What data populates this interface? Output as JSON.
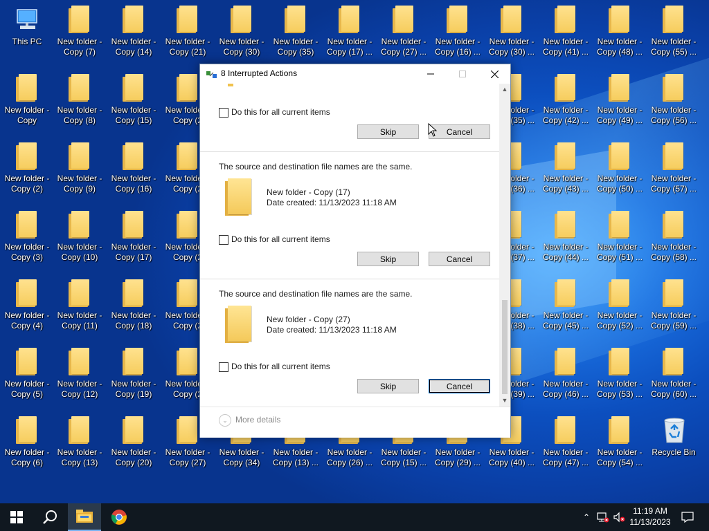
{
  "desktop": {
    "icons": [
      {
        "label": "This PC",
        "type": "pc"
      },
      {
        "label": "New folder - Copy (7)",
        "type": "folder"
      },
      {
        "label": "New folder - Copy (14)",
        "type": "folder"
      },
      {
        "label": "New folder - Copy (21)",
        "type": "folder"
      },
      {
        "label": "New folder - Copy (30)",
        "type": "folder"
      },
      {
        "label": "New folder - Copy (35)",
        "type": "folder"
      },
      {
        "label": "New folder - Copy (17) ...",
        "type": "folder"
      },
      {
        "label": "New folder - Copy (27) ...",
        "type": "folder"
      },
      {
        "label": "New folder - Copy (16) ...",
        "type": "folder"
      },
      {
        "label": "New folder - Copy (30) ...",
        "type": "folder"
      },
      {
        "label": "New folder - Copy (41) ...",
        "type": "folder"
      },
      {
        "label": "New folder - Copy (48) ...",
        "type": "folder"
      },
      {
        "label": "New folder - Copy (55) ...",
        "type": "folder"
      },
      {
        "label": "New folder - Copy",
        "type": "folder"
      },
      {
        "label": "New folder - Copy (8)",
        "type": "folder"
      },
      {
        "label": "New folder - Copy (15)",
        "type": "folder"
      },
      {
        "label": "New folder - Copy (2",
        "type": "folder"
      },
      {
        "label": "New folder - Copy (35) ...",
        "type": "folder"
      },
      {
        "label": "New folder - Copy (42) ...",
        "type": "folder"
      },
      {
        "label": "New folder - Copy (49) ...",
        "type": "folder"
      },
      {
        "label": "New folder - Copy (56) ...",
        "type": "folder"
      },
      {
        "label": "New folder - Copy (2)",
        "type": "folder"
      },
      {
        "label": "New folder - Copy (9)",
        "type": "folder"
      },
      {
        "label": "New folder - Copy (16)",
        "type": "folder"
      },
      {
        "label": "New folder - Copy (2",
        "type": "folder"
      },
      {
        "label": "New folder - Copy (36) ...",
        "type": "folder"
      },
      {
        "label": "New folder - Copy (43) ...",
        "type": "folder"
      },
      {
        "label": "New folder - Copy (50) ...",
        "type": "folder"
      },
      {
        "label": "New folder - Copy (57) ...",
        "type": "folder"
      },
      {
        "label": "New folder - Copy (3)",
        "type": "folder"
      },
      {
        "label": "New folder - Copy (10)",
        "type": "folder"
      },
      {
        "label": "New folder - Copy (17)",
        "type": "folder"
      },
      {
        "label": "New folder - Copy (2",
        "type": "folder"
      },
      {
        "label": "New folder - Copy (37) ...",
        "type": "folder"
      },
      {
        "label": "New folder - Copy (44) ...",
        "type": "folder"
      },
      {
        "label": "New folder - Copy (51) ...",
        "type": "folder"
      },
      {
        "label": "New folder - Copy (58) ...",
        "type": "folder"
      },
      {
        "label": "New folder - Copy (4)",
        "type": "folder"
      },
      {
        "label": "New folder - Copy (11)",
        "type": "folder"
      },
      {
        "label": "New folder - Copy (18)",
        "type": "folder"
      },
      {
        "label": "New folder - Copy (2",
        "type": "folder"
      },
      {
        "label": "New folder - Copy (38) ...",
        "type": "folder"
      },
      {
        "label": "New folder - Copy (45) ...",
        "type": "folder"
      },
      {
        "label": "New folder - Copy (52) ...",
        "type": "folder"
      },
      {
        "label": "New folder - Copy (59) ...",
        "type": "folder"
      },
      {
        "label": "New folder - Copy (5)",
        "type": "folder"
      },
      {
        "label": "New folder - Copy (12)",
        "type": "folder"
      },
      {
        "label": "New folder - Copy (19)",
        "type": "folder"
      },
      {
        "label": "New folder - Copy (2",
        "type": "folder"
      },
      {
        "label": "New folder - Copy (39) ...",
        "type": "folder"
      },
      {
        "label": "New folder - Copy (46) ...",
        "type": "folder"
      },
      {
        "label": "New folder - Copy (53) ...",
        "type": "folder"
      },
      {
        "label": "New folder - Copy (60) ...",
        "type": "folder"
      },
      {
        "label": "New folder - Copy (6)",
        "type": "folder"
      },
      {
        "label": "New folder - Copy (13)",
        "type": "folder"
      },
      {
        "label": "New folder - Copy (20)",
        "type": "folder"
      },
      {
        "label": "New folder - Copy (27)",
        "type": "folder"
      },
      {
        "label": "New folder - Copy (34)",
        "type": "folder"
      },
      {
        "label": "New folder - Copy (13) ...",
        "type": "folder"
      },
      {
        "label": "New folder - Copy (26) ...",
        "type": "folder"
      },
      {
        "label": "New folder - Copy (15) ...",
        "type": "folder"
      },
      {
        "label": "New folder - Copy (29) ...",
        "type": "folder"
      },
      {
        "label": "New folder - Copy (40) ...",
        "type": "folder"
      },
      {
        "label": "New folder - Copy (47) ...",
        "type": "folder"
      },
      {
        "label": "New folder - Copy (54) ...",
        "type": "folder"
      },
      {
        "label": "Recycle Bin",
        "type": "bin"
      }
    ]
  },
  "dialog": {
    "title": "8 Interrupted Actions",
    "items": [
      {
        "message": "",
        "file_name": "",
        "date_created": "",
        "checkbox_label": "Do this for all current items",
        "skip_label": "Skip",
        "cancel_label": "Cancel"
      },
      {
        "message": "The source and destination file names are the same.",
        "file_name": "New folder - Copy (17)",
        "date_created": "Date created: 11/13/2023 11:18 AM",
        "checkbox_label": "Do this for all current items",
        "skip_label": "Skip",
        "cancel_label": "Cancel"
      },
      {
        "message": "The source and destination file names are the same.",
        "file_name": "New folder - Copy (27)",
        "date_created": "Date created: 11/13/2023 11:18 AM",
        "checkbox_label": "Do this for all current items",
        "skip_label": "Skip",
        "cancel_label": "Cancel"
      }
    ],
    "more_details_label": "More details"
  },
  "taskbar": {
    "time": "11:19 AM",
    "date": "11/13/2023"
  },
  "colors": {
    "desktop_bg": "#0c4fbf",
    "folder": "#f6cd5e",
    "taskbar": "#101820",
    "focus_accent": "#0078d7"
  }
}
